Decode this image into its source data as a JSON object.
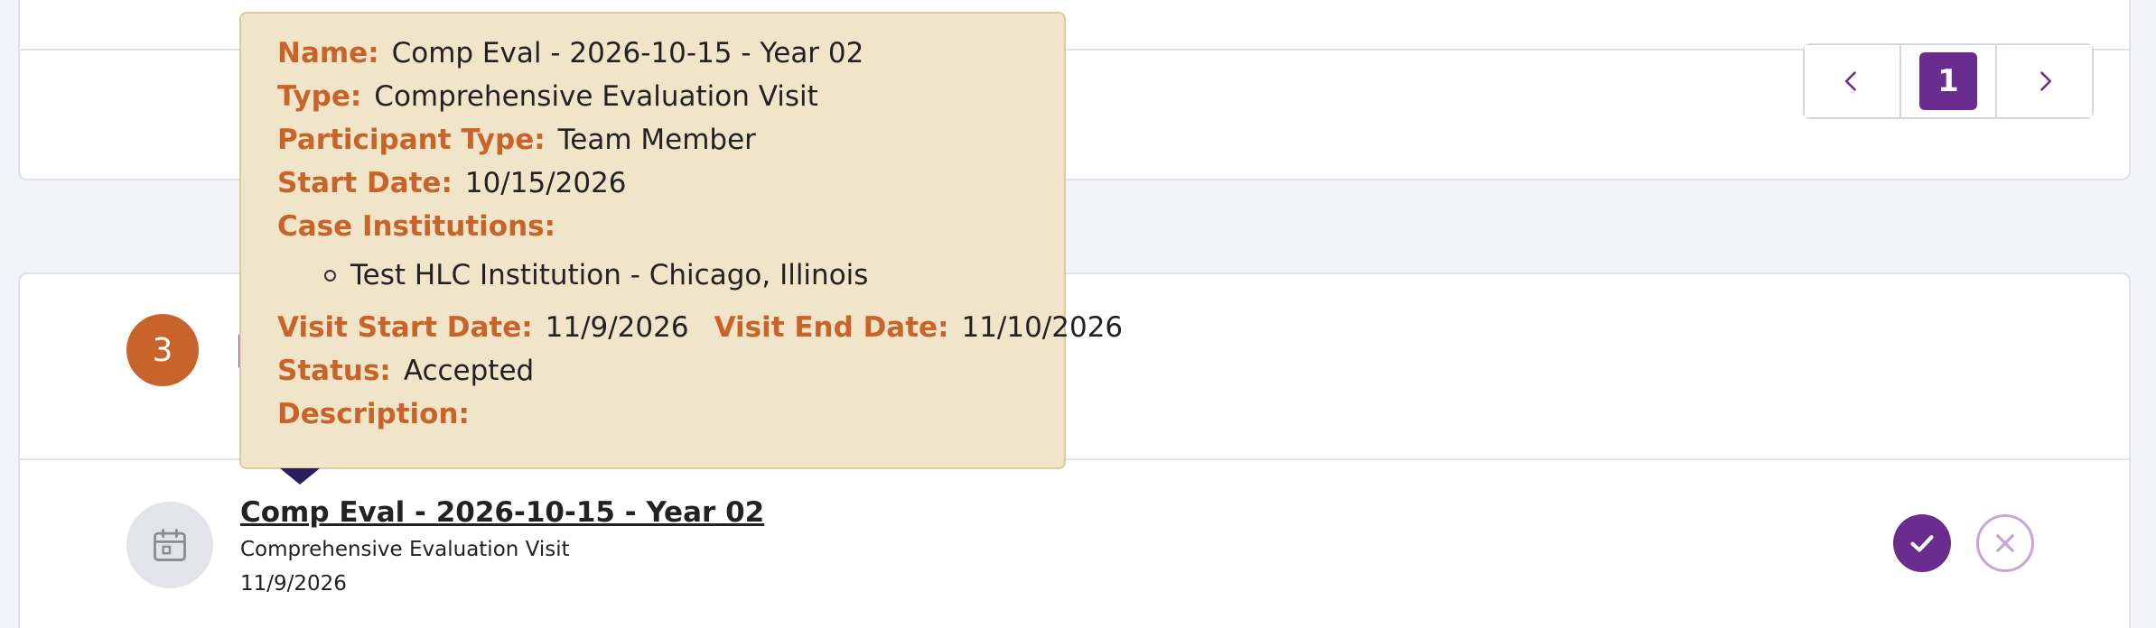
{
  "pagination": {
    "current_page": "1"
  },
  "section": {
    "count": "3"
  },
  "event": {
    "title": "Comp Eval - 2026-10-15 - Year 02",
    "type": "Comprehensive Evaluation Visit",
    "date": "11/9/2026"
  },
  "tooltip": {
    "name_label": "Name:",
    "name_value": "Comp Eval - 2026-10-15 - Year 02",
    "type_label": "Type:",
    "type_value": "Comprehensive Evaluation Visit",
    "participant_label": "Participant Type:",
    "participant_value": "Team Member",
    "start_label": "Start Date:",
    "start_value": "10/15/2026",
    "institutions_label": "Case Institutions:",
    "institutions": [
      "Test HLC Institution - Chicago, Illinois"
    ],
    "visit_start_label": "Visit Start Date:",
    "visit_start_value": "11/9/2026",
    "visit_end_label": "Visit End Date:",
    "visit_end_value": "11/10/2026",
    "status_label": "Status:",
    "status_value": "Accepted",
    "description_label": "Description:",
    "description_value": ""
  },
  "colors": {
    "brand_purple": "#6b2c8f",
    "accent_orange": "#c8632a",
    "tooltip_bg": "#f1e5c9"
  },
  "icons": {
    "prev": "chevron-left-icon",
    "next": "chevron-right-icon",
    "event": "calendar-icon",
    "accept": "check-icon",
    "decline": "close-icon"
  }
}
